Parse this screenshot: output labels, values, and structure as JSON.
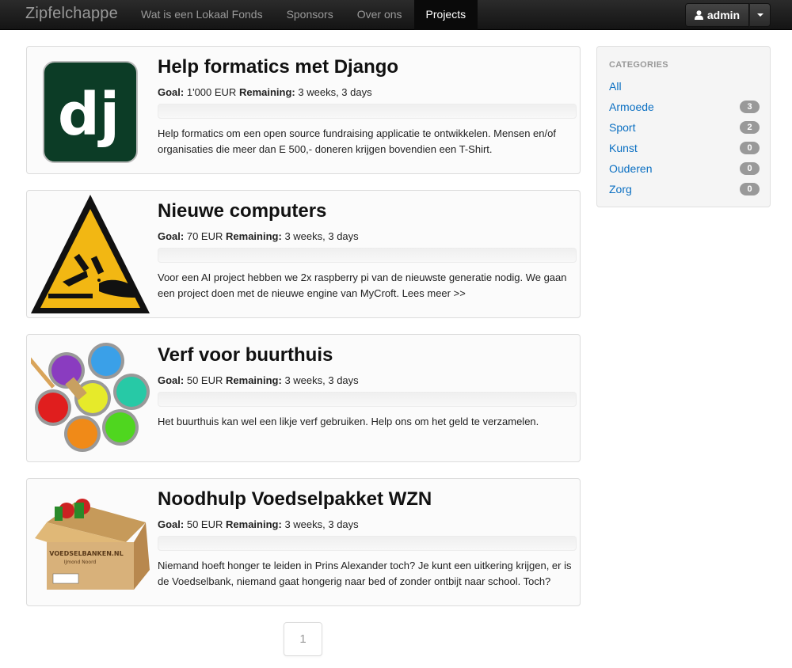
{
  "brand": "Zipfelchappe",
  "nav": [
    {
      "label": "Wat is een Lokaal Fonds",
      "active": false
    },
    {
      "label": "Sponsors",
      "active": false
    },
    {
      "label": "Over ons",
      "active": false
    },
    {
      "label": "Projects",
      "active": true
    }
  ],
  "user": {
    "name": "admin"
  },
  "labels": {
    "goal": "Goal:",
    "remaining": "Remaining:"
  },
  "projects": [
    {
      "title": "Help formatics met Django",
      "goal": "1'000 EUR",
      "remaining": "3 weeks, 3 days",
      "progress": 0,
      "description": "Help formatics om een open source fundraising applicatie te ontwikkelen. Mensen en/of organisaties die meer dan E 500,- doneren krijgen bovendien een T-Shirt.",
      "image": "django-logo"
    },
    {
      "title": "Nieuwe computers",
      "goal": "70 EUR",
      "remaining": "3 weeks, 3 days",
      "progress": 0,
      "description": "Voor een AI project hebben we 2x raspberry pi van de nieuwste generatie nodig. We gaan een project doen met de nieuwe engine van MyCroft. Lees meer >>",
      "image": "corrosive-warning-sign"
    },
    {
      "title": "Verf voor buurthuis",
      "goal": "50 EUR",
      "remaining": "3 weeks, 3 days",
      "progress": 0,
      "description": "Het buurthuis kan wel een likje verf gebruiken. Help ons om het geld te verzamelen.",
      "image": "paint-cans"
    },
    {
      "title": "Noodhulp Voedselpakket WZN",
      "goal": "50 EUR",
      "remaining": "3 weeks, 3 days",
      "progress": 0,
      "description": "Niemand hoeft honger te leiden in Prins Alexander toch? Je kunt een uitkering krijgen, er is de Voedselbank, niemand gaat hongerig naar bed of zonder ontbijt naar school. Toch?",
      "image": "food-box"
    }
  ],
  "sidebar": {
    "header": "CATEGORIES",
    "categories": [
      {
        "label": "All",
        "count": ""
      },
      {
        "label": "Armoede",
        "count": "3"
      },
      {
        "label": "Sport",
        "count": "2"
      },
      {
        "label": "Kunst",
        "count": "0"
      },
      {
        "label": "Ouderen",
        "count": "0"
      },
      {
        "label": "Zorg",
        "count": "0"
      }
    ]
  },
  "pagination": {
    "current": "1"
  },
  "food_box_text": {
    "brand": "VOEDSELBANKEN.NL",
    "region": "IJmond Noord"
  }
}
